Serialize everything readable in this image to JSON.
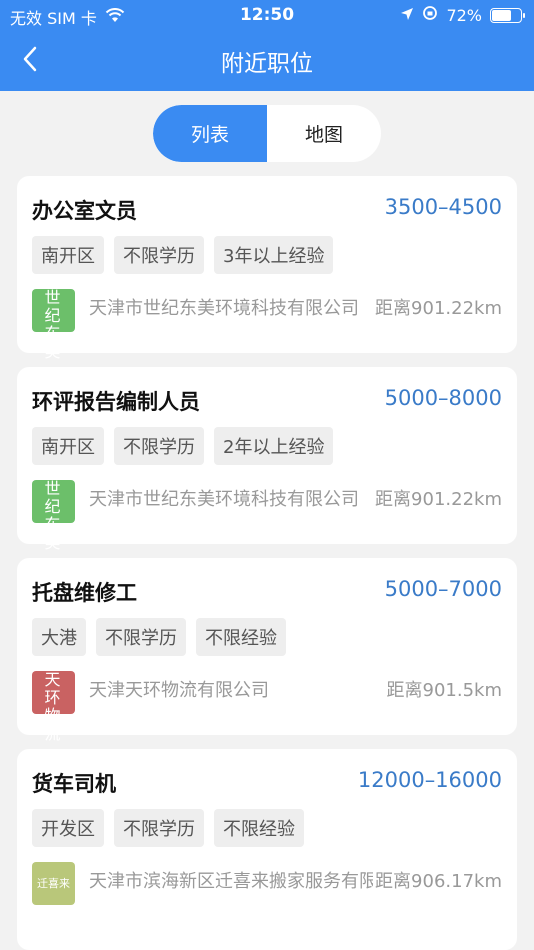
{
  "status_bar": {
    "carrier": "无效 SIM 卡",
    "time": "12:50",
    "battery": "72%",
    "battery_level": 0.72
  },
  "nav": {
    "title": "附近职位"
  },
  "segment": {
    "list_label": "列表",
    "map_label": "地图"
  },
  "jobs": [
    {
      "title": "办公室文员",
      "salary": "3500–4500",
      "tags": [
        "南开区",
        "不限学历",
        "3年以上经验"
      ],
      "logo_text": "世纪东美",
      "logo_color": "#6cbf6a",
      "company": "天津市世纪东美环境科技有限公司",
      "distance": "距离901.22km"
    },
    {
      "title": "环评报告编制人员",
      "salary": "5000–8000",
      "tags": [
        "南开区",
        "不限学历",
        "2年以上经验"
      ],
      "logo_text": "世纪东美",
      "logo_color": "#6cbf6a",
      "company": "天津市世纪东美环境科技有限公司",
      "distance": "距离901.22km"
    },
    {
      "title": "托盘维修工",
      "salary": "5000–7000",
      "tags": [
        "大港",
        "不限学历",
        "不限经验"
      ],
      "logo_text": "天环物流",
      "logo_color": "#c96262",
      "company": "天津天环物流有限公司",
      "distance": "距离901.5km"
    },
    {
      "title": "货车司机",
      "salary": "12000–16000",
      "tags": [
        "开发区",
        "不限学历",
        "不限经验"
      ],
      "logo_text": "迁喜来",
      "logo_color": "#b9c77a",
      "company": "天津市滨海新区迁喜来搬家服务有限",
      "distance": "距离906.17km"
    }
  ]
}
